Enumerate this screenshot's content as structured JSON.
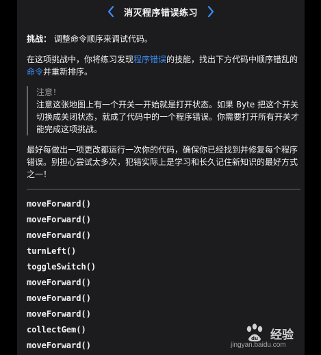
{
  "nav": {
    "title": "消灭程序错误练习",
    "prev_icon": "chevron-left-icon",
    "next_icon": "chevron-right-icon",
    "accent": "#3b8cf5"
  },
  "goal": {
    "label": "挑战：",
    "text": "调整命令顺序来调试代码。"
  },
  "intro": {
    "part1": "在这项挑战中，你将练习发现",
    "link1": "程序错误",
    "part2": "的技能，找出下方代码中顺序错乱的",
    "link2": "命令",
    "part3": "并重新排序。"
  },
  "note": {
    "heading": "注意！",
    "text": "注意这张地图上有一个开关一开始就是打开状态。如果 Byte 把这个开关切换成关闭状态，就成了代码中的一个程序错误。你需要打开所有开关才能完成这项挑战。"
  },
  "tip": {
    "text": "最好每做出一项更改都运行一次你的代码，确保你已经找到并修复每个程序错误。别担心尝试太多次，犯错实际上是学习和长久记住新知识的最好方式之一！"
  },
  "code": [
    "moveForward()",
    "moveForward()",
    "moveForward()",
    "turnLeft()",
    "toggleSwitch()",
    "moveForward()",
    "moveForward()",
    "moveForward()",
    "collectGem()",
    "moveForward()"
  ],
  "watermark": {
    "brand": "经验",
    "url": "jingyan.baidu.com"
  }
}
